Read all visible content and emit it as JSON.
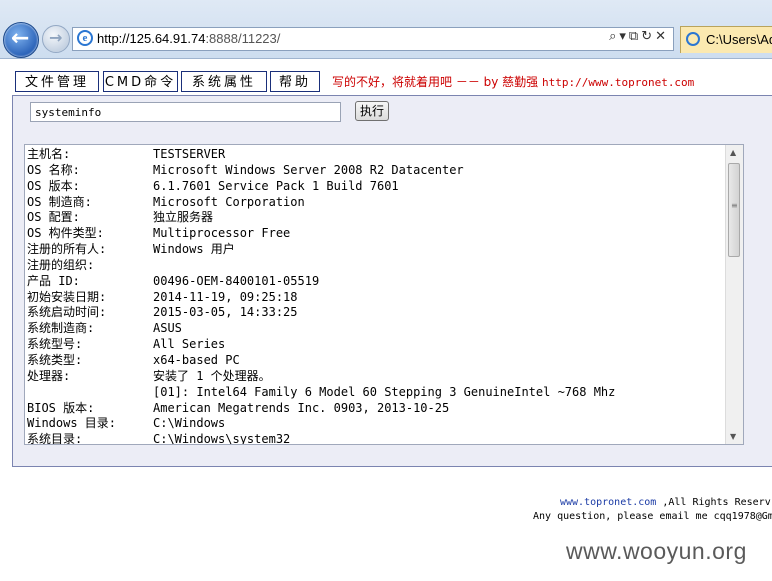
{
  "browser": {
    "address_host": "http://125.64.91.74",
    "address_rest": ":8888/11223/",
    "url_tools": "⌕▾⧉↻✕",
    "tab_label": "C:\\Users\\Ad"
  },
  "menu": {
    "file_manager": "文件管理",
    "cmd": "CMD命令",
    "sys_props": "系统属性",
    "help": "帮助"
  },
  "credit": {
    "text": "写的不好，将就着用吧 －－ by 慈勤强 ",
    "url": "http://www.topronet.com"
  },
  "command": {
    "value": "systeminfo",
    "run_label": "执行"
  },
  "output": [
    {
      "key": "主机名:",
      "value": "TESTSERVER"
    },
    {
      "key": "OS 名称:",
      "value": "Microsoft Windows Server 2008 R2 Datacenter"
    },
    {
      "key": "OS 版本:",
      "value": "6.1.7601 Service Pack 1 Build 7601"
    },
    {
      "key": "OS 制造商:",
      "value": "Microsoft Corporation"
    },
    {
      "key": "OS 配置:",
      "value": "独立服务器"
    },
    {
      "key": "OS 构件类型:",
      "value": "Multiprocessor Free"
    },
    {
      "key": "注册的所有人:",
      "value": "Windows 用户"
    },
    {
      "key": "注册的组织:",
      "value": ""
    },
    {
      "key": "产品 ID:",
      "value": "00496-OEM-8400101-05519"
    },
    {
      "key": "初始安装日期:",
      "value": "2014-11-19, 09:25:18"
    },
    {
      "key": "系统启动时间:",
      "value": "2015-03-05, 14:33:25"
    },
    {
      "key": "系统制造商:",
      "value": "ASUS"
    },
    {
      "key": "系统型号:",
      "value": "All Series"
    },
    {
      "key": "系统类型:",
      "value": "x64-based PC"
    },
    {
      "key": "处理器:",
      "value": "安装了 1 个处理器。"
    },
    {
      "key": "",
      "value": "[01]: Intel64 Family 6 Model 60 Stepping 3 GenuineIntel ~768 Mhz"
    },
    {
      "key": "BIOS 版本:",
      "value": "American Megatrends Inc. 0903, 2013-10-25"
    },
    {
      "key": "Windows 目录:",
      "value": "C:\\Windows"
    },
    {
      "key": "系统目录:",
      "value": "C:\\Windows\\system32"
    }
  ],
  "footer": {
    "link": "www.topronet.com",
    "rights": " ,All Rights Reserv",
    "contact": "Any question, please email me cqq1978@Gm"
  },
  "watermark": "www.wooyun.org"
}
